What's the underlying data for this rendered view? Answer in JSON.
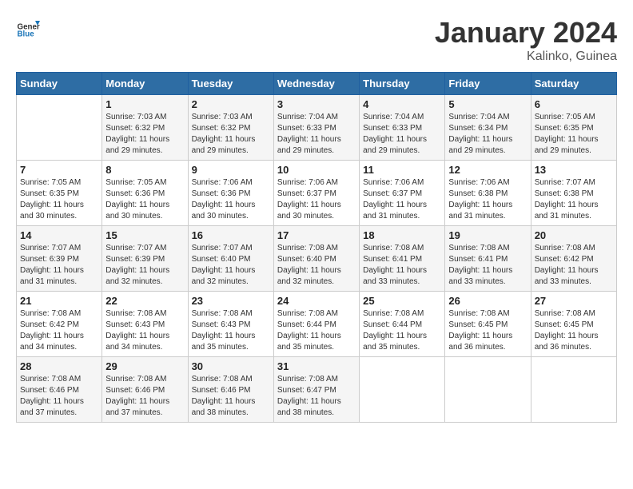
{
  "header": {
    "logo_general": "General",
    "logo_blue": "Blue",
    "title": "January 2024",
    "subtitle": "Kalinko, Guinea"
  },
  "days_of_week": [
    "Sunday",
    "Monday",
    "Tuesday",
    "Wednesday",
    "Thursday",
    "Friday",
    "Saturday"
  ],
  "weeks": [
    [
      {
        "day": "",
        "detail": ""
      },
      {
        "day": "1",
        "detail": "Sunrise: 7:03 AM\nSunset: 6:32 PM\nDaylight: 11 hours\nand 29 minutes."
      },
      {
        "day": "2",
        "detail": "Sunrise: 7:03 AM\nSunset: 6:32 PM\nDaylight: 11 hours\nand 29 minutes."
      },
      {
        "day": "3",
        "detail": "Sunrise: 7:04 AM\nSunset: 6:33 PM\nDaylight: 11 hours\nand 29 minutes."
      },
      {
        "day": "4",
        "detail": "Sunrise: 7:04 AM\nSunset: 6:33 PM\nDaylight: 11 hours\nand 29 minutes."
      },
      {
        "day": "5",
        "detail": "Sunrise: 7:04 AM\nSunset: 6:34 PM\nDaylight: 11 hours\nand 29 minutes."
      },
      {
        "day": "6",
        "detail": "Sunrise: 7:05 AM\nSunset: 6:35 PM\nDaylight: 11 hours\nand 29 minutes."
      }
    ],
    [
      {
        "day": "7",
        "detail": "Sunrise: 7:05 AM\nSunset: 6:35 PM\nDaylight: 11 hours\nand 30 minutes."
      },
      {
        "day": "8",
        "detail": "Sunrise: 7:05 AM\nSunset: 6:36 PM\nDaylight: 11 hours\nand 30 minutes."
      },
      {
        "day": "9",
        "detail": "Sunrise: 7:06 AM\nSunset: 6:36 PM\nDaylight: 11 hours\nand 30 minutes."
      },
      {
        "day": "10",
        "detail": "Sunrise: 7:06 AM\nSunset: 6:37 PM\nDaylight: 11 hours\nand 30 minutes."
      },
      {
        "day": "11",
        "detail": "Sunrise: 7:06 AM\nSunset: 6:37 PM\nDaylight: 11 hours\nand 31 minutes."
      },
      {
        "day": "12",
        "detail": "Sunrise: 7:06 AM\nSunset: 6:38 PM\nDaylight: 11 hours\nand 31 minutes."
      },
      {
        "day": "13",
        "detail": "Sunrise: 7:07 AM\nSunset: 6:38 PM\nDaylight: 11 hours\nand 31 minutes."
      }
    ],
    [
      {
        "day": "14",
        "detail": "Sunrise: 7:07 AM\nSunset: 6:39 PM\nDaylight: 11 hours\nand 31 minutes."
      },
      {
        "day": "15",
        "detail": "Sunrise: 7:07 AM\nSunset: 6:39 PM\nDaylight: 11 hours\nand 32 minutes."
      },
      {
        "day": "16",
        "detail": "Sunrise: 7:07 AM\nSunset: 6:40 PM\nDaylight: 11 hours\nand 32 minutes."
      },
      {
        "day": "17",
        "detail": "Sunrise: 7:08 AM\nSunset: 6:40 PM\nDaylight: 11 hours\nand 32 minutes."
      },
      {
        "day": "18",
        "detail": "Sunrise: 7:08 AM\nSunset: 6:41 PM\nDaylight: 11 hours\nand 33 minutes."
      },
      {
        "day": "19",
        "detail": "Sunrise: 7:08 AM\nSunset: 6:41 PM\nDaylight: 11 hours\nand 33 minutes."
      },
      {
        "day": "20",
        "detail": "Sunrise: 7:08 AM\nSunset: 6:42 PM\nDaylight: 11 hours\nand 33 minutes."
      }
    ],
    [
      {
        "day": "21",
        "detail": "Sunrise: 7:08 AM\nSunset: 6:42 PM\nDaylight: 11 hours\nand 34 minutes."
      },
      {
        "day": "22",
        "detail": "Sunrise: 7:08 AM\nSunset: 6:43 PM\nDaylight: 11 hours\nand 34 minutes."
      },
      {
        "day": "23",
        "detail": "Sunrise: 7:08 AM\nSunset: 6:43 PM\nDaylight: 11 hours\nand 35 minutes."
      },
      {
        "day": "24",
        "detail": "Sunrise: 7:08 AM\nSunset: 6:44 PM\nDaylight: 11 hours\nand 35 minutes."
      },
      {
        "day": "25",
        "detail": "Sunrise: 7:08 AM\nSunset: 6:44 PM\nDaylight: 11 hours\nand 35 minutes."
      },
      {
        "day": "26",
        "detail": "Sunrise: 7:08 AM\nSunset: 6:45 PM\nDaylight: 11 hours\nand 36 minutes."
      },
      {
        "day": "27",
        "detail": "Sunrise: 7:08 AM\nSunset: 6:45 PM\nDaylight: 11 hours\nand 36 minutes."
      }
    ],
    [
      {
        "day": "28",
        "detail": "Sunrise: 7:08 AM\nSunset: 6:46 PM\nDaylight: 11 hours\nand 37 minutes."
      },
      {
        "day": "29",
        "detail": "Sunrise: 7:08 AM\nSunset: 6:46 PM\nDaylight: 11 hours\nand 37 minutes."
      },
      {
        "day": "30",
        "detail": "Sunrise: 7:08 AM\nSunset: 6:46 PM\nDaylight: 11 hours\nand 38 minutes."
      },
      {
        "day": "31",
        "detail": "Sunrise: 7:08 AM\nSunset: 6:47 PM\nDaylight: 11 hours\nand 38 minutes."
      },
      {
        "day": "",
        "detail": ""
      },
      {
        "day": "",
        "detail": ""
      },
      {
        "day": "",
        "detail": ""
      }
    ]
  ]
}
